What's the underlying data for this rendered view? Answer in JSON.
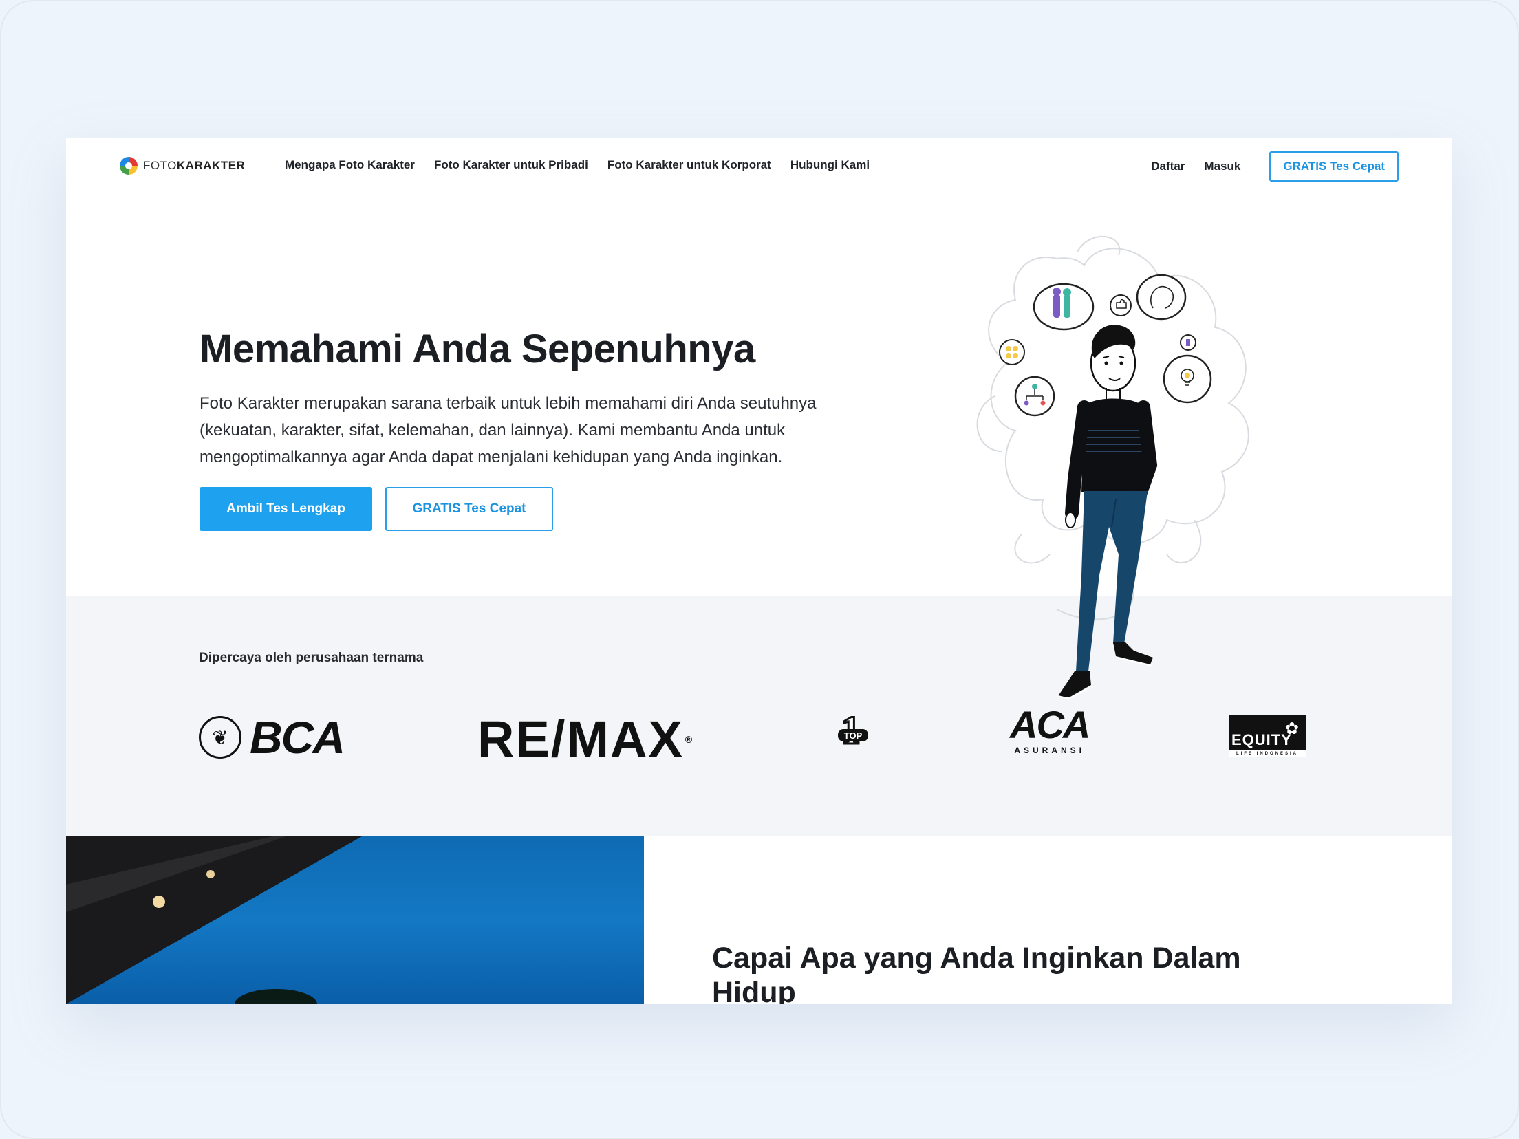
{
  "brand": {
    "name_light": "FOTO",
    "name_bold": "KARAKTER"
  },
  "nav": {
    "links": [
      "Mengapa Foto Karakter",
      "Foto Karakter untuk Pribadi",
      "Foto Karakter untuk Korporat",
      "Hubungi Kami"
    ],
    "register": "Daftar",
    "login": "Masuk",
    "cta": "GRATIS Tes Cepat"
  },
  "hero": {
    "title": "Memahami Anda Sepenuhnya",
    "description": "Foto Karakter merupakan sarana terbaik untuk lebih memahami diri Anda seutuhnya (kekuatan, karakter, sifat, kelemahan, dan lainnya). Kami membantu Anda untuk mengoptimalkannya agar Anda dapat menjalani kehidupan yang Anda inginkan.",
    "primary_button": "Ambil Tes Lengkap",
    "secondary_button": "GRATIS Tes Cepat"
  },
  "trust": {
    "label": "Dipercaya oleh perusahaan ternama",
    "logos": {
      "bca": "BCA",
      "remax": "RE/MAX",
      "remax_mark": "®",
      "top1_num": "1",
      "top1_badge": "TOP",
      "aca": "ACA",
      "aca_sub": "ASURANSI",
      "equity": "EQUITY",
      "equity_sub": "LIFE INDONESIA"
    }
  },
  "feature": {
    "title": "Capai Apa yang Anda Inginkan Dalam Hidup"
  },
  "colors": {
    "accent": "#1ea2f0",
    "outline": "#2a9ee8",
    "band": "#f3f5f8"
  }
}
